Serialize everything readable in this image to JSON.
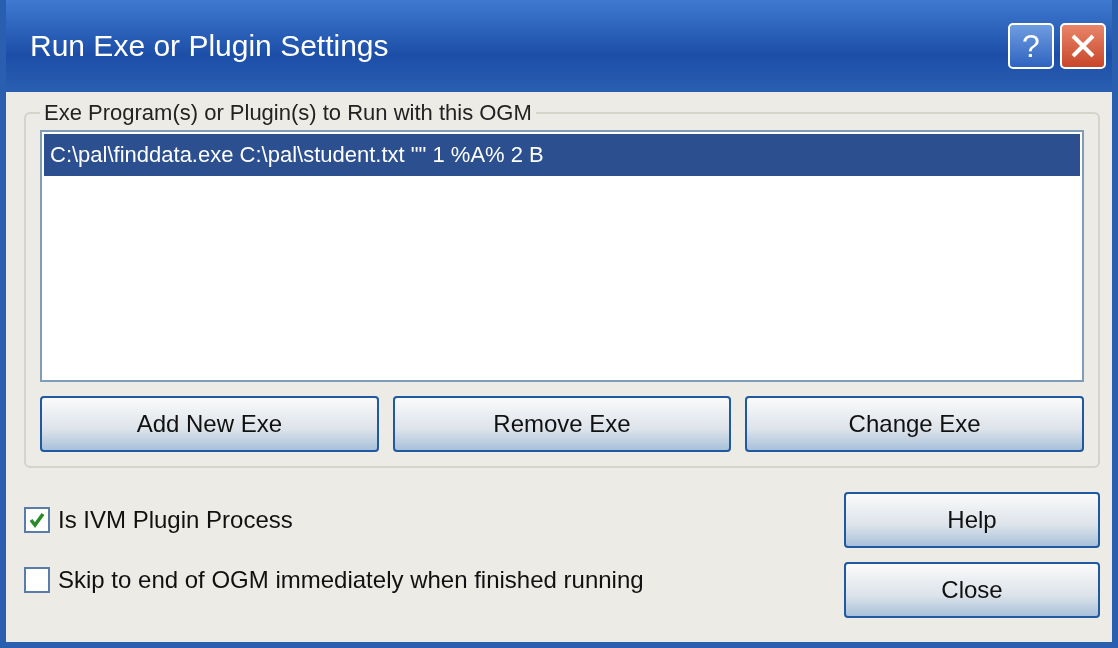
{
  "window": {
    "title": "Run Exe or Plugin Settings",
    "help_button": "?"
  },
  "group": {
    "label": "Exe Program(s) or Plugin(s) to Run with this OGM",
    "list": [
      {
        "text": "C:\\pal\\finddata.exe C:\\pal\\student.txt \"\" 1 %A% 2 B",
        "selected": true
      }
    ],
    "buttons": [
      "Add New Exe",
      "Remove Exe",
      "Change Exe"
    ]
  },
  "options": [
    {
      "label": "Is IVM Plugin Process",
      "checked": true
    },
    {
      "label": "Skip to end of OGM immediately when finished running",
      "checked": false
    }
  ],
  "side_buttons": [
    "Help",
    "Close"
  ]
}
